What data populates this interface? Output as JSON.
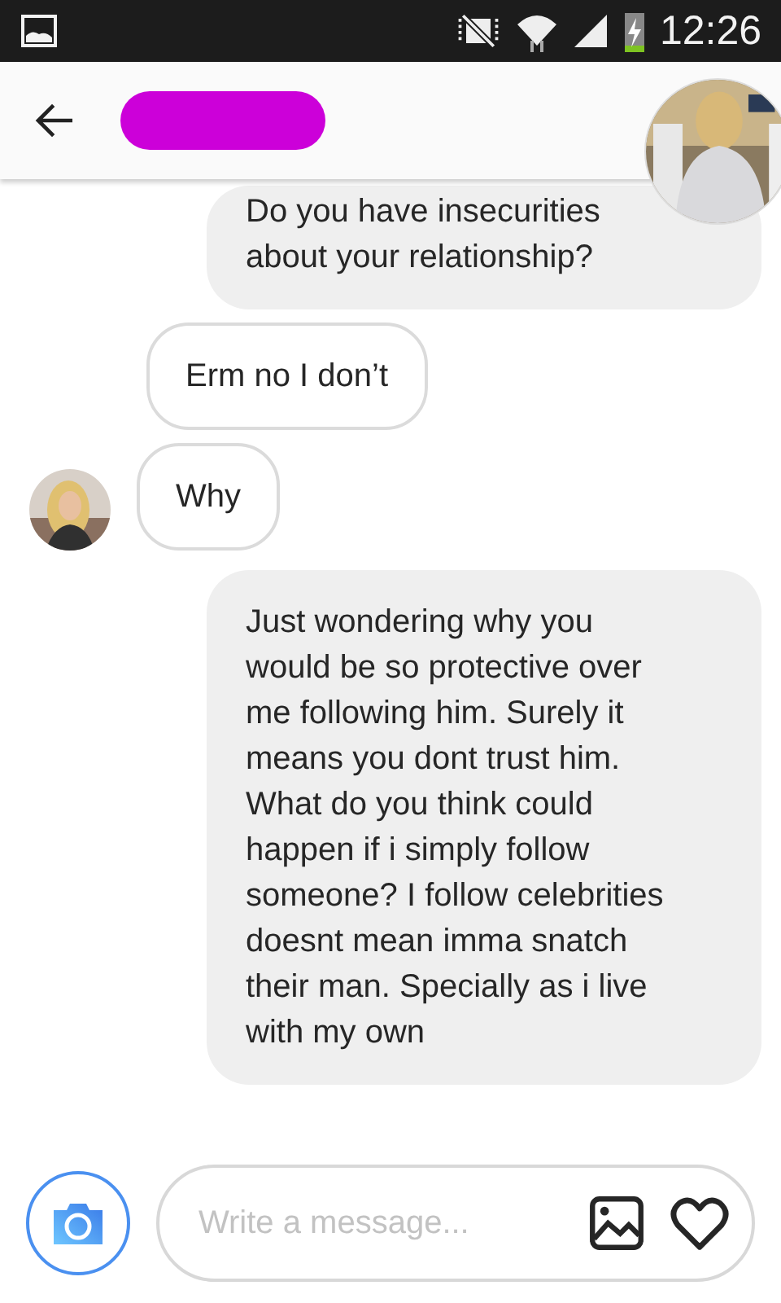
{
  "status_bar": {
    "time": "12:26"
  },
  "header": {
    "kind": "redacted"
  },
  "messages": [
    {
      "kind": "sent",
      "text": "Do you have insecurities about your relationship?",
      "avatar": false
    },
    {
      "kind": "received",
      "text": "Erm no I don’t",
      "avatar": false
    },
    {
      "kind": "received",
      "text": "Why",
      "avatar": true
    },
    {
      "kind": "sent",
      "text": "Just wondering why you would be so protective over me following him. Surely it means you dont trust him. What do you think could happen if i simply follow someone? I follow celebrities doesnt mean imma snatch their man. Specially as i live with my own",
      "avatar": false
    }
  ],
  "composer": {
    "placeholder": "Write a message..."
  }
}
